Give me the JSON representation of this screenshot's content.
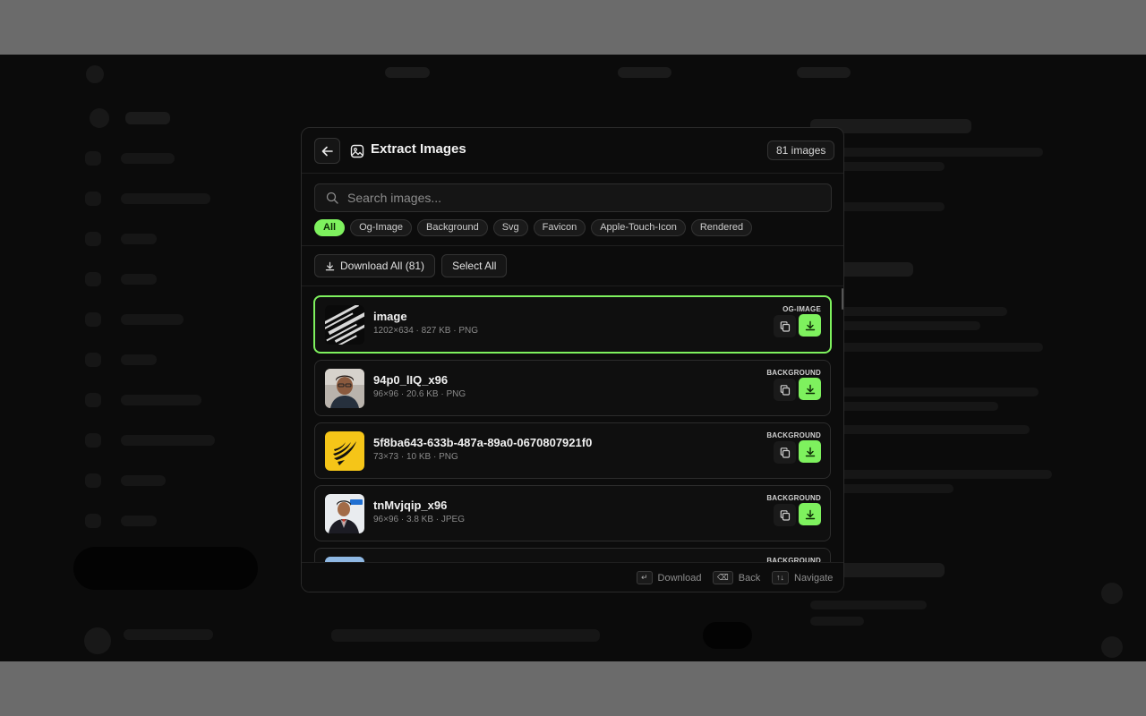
{
  "modal": {
    "title": "Extract Images",
    "image_count": "81 images",
    "search_placeholder": "Search images...",
    "filters": [
      "All",
      "Og-Image",
      "Background",
      "Svg",
      "Favicon",
      "Apple-Touch-Icon",
      "Rendered"
    ],
    "active_filter": "All",
    "download_all_label": "Download All (81)",
    "select_all_label": "Select All",
    "images": [
      {
        "name": "image",
        "meta": "1202×634 · 827 KB · PNG",
        "type": "OG-IMAGE",
        "selected": true
      },
      {
        "name": "94p0_lIQ_x96",
        "meta": "96×96 · 20.6 KB · PNG",
        "type": "BACKGROUND",
        "selected": false
      },
      {
        "name": "5f8ba643-633b-487a-89a0-0670807921f0",
        "meta": "73×73 · 10 KB · PNG",
        "type": "BACKGROUND",
        "selected": false
      },
      {
        "name": "tnMvjqip_x96",
        "meta": "96×96 · 3.8 KB · JPEG",
        "type": "BACKGROUND",
        "selected": false
      },
      {
        "name": "",
        "meta": "",
        "type": "BACKGROUND",
        "selected": false
      }
    ],
    "footer": {
      "download_key": "↵",
      "download_label": "Download",
      "back_key": "⌫",
      "back_label": "Back",
      "navigate_key": "↑↓",
      "navigate_label": "Navigate"
    }
  },
  "colors": {
    "accent": "#7ef15e",
    "modal_bg": "#0c0c0c",
    "border": "#2c2c2c"
  }
}
